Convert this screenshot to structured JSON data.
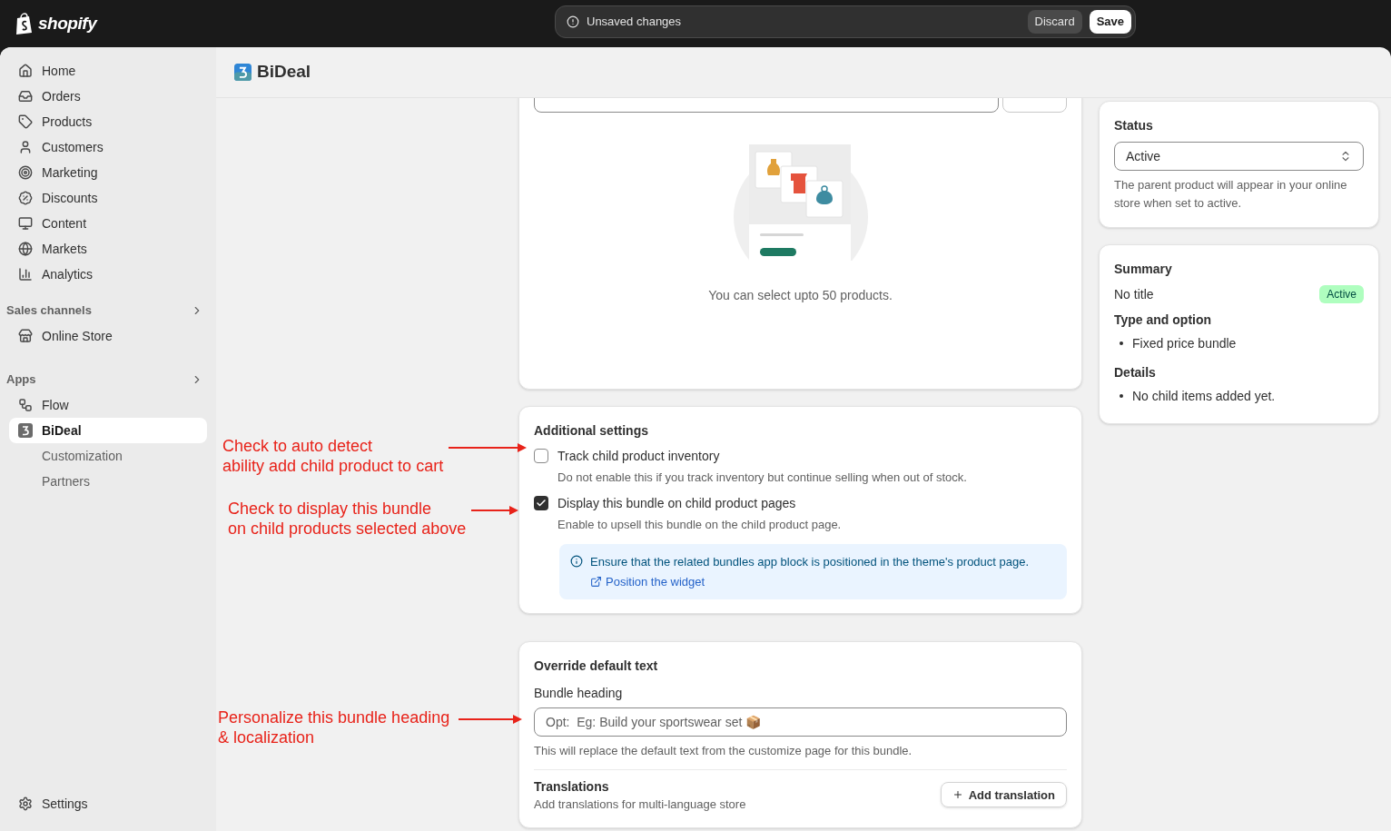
{
  "topbar": {
    "logo": "shopify",
    "message": "Unsaved changes",
    "discard": "Discard",
    "save": "Save"
  },
  "sidebar": {
    "items": [
      {
        "label": "Home",
        "selected": false
      },
      {
        "label": "Orders",
        "selected": false
      },
      {
        "label": "Products",
        "selected": false
      },
      {
        "label": "Customers",
        "selected": false
      },
      {
        "label": "Marketing",
        "selected": false
      },
      {
        "label": "Discounts",
        "selected": false
      },
      {
        "label": "Content",
        "selected": false
      },
      {
        "label": "Markets",
        "selected": false
      },
      {
        "label": "Analytics",
        "selected": false
      }
    ],
    "sales_channels": {
      "title": "Sales channels",
      "items": [
        {
          "label": "Online Store",
          "selected": false
        }
      ]
    },
    "apps": {
      "title": "Apps",
      "items": [
        {
          "label": "Flow",
          "selected": false
        },
        {
          "label": "BiDeal",
          "selected": true,
          "children": [
            {
              "label": "Customization",
              "selected": false
            },
            {
              "label": "Partners",
              "selected": false
            }
          ]
        }
      ]
    },
    "settings": "Settings"
  },
  "page": {
    "title": "BiDeal"
  },
  "products_card": {
    "note": "You can select upto 50 products."
  },
  "additional_settings": {
    "title": "Additional settings",
    "options": [
      {
        "label": "Track child product inventory",
        "help": "Do not enable this if you track inventory but continue selling when out of stock.",
        "checked": false
      },
      {
        "label": "Display this bundle on child product pages",
        "help": "Enable to upsell this bundle on the child product page.",
        "checked": true
      }
    ],
    "banner": {
      "text": "Ensure that the related bundles app block is positioned in the theme's product page.",
      "link": "Position the widget"
    }
  },
  "override": {
    "title": "Override default text",
    "field_label": "Bundle heading",
    "placeholder": "Opt:  Eg: Build your sportswear set 📦",
    "help": "This will replace the default text from the customize page for this bundle.",
    "translations_title": "Translations",
    "translations_help": "Add translations for multi-language store",
    "add_translation": "Add translation"
  },
  "status": {
    "title": "Status",
    "value": "Active",
    "help": "The parent product will appear in your online store when set to active."
  },
  "summary": {
    "title": "Summary",
    "name": "No title",
    "badge": "Active",
    "sections": [
      {
        "heading": "Type and option",
        "items": [
          "Fixed price bundle"
        ]
      },
      {
        "heading": "Details",
        "items": [
          "No child items added yet."
        ]
      }
    ]
  },
  "annotations": [
    {
      "text": "Check to auto detect\nability add child product to cart"
    },
    {
      "text": "Check to display this bundle\non child products selected above"
    },
    {
      "text": "Personalize this bundle heading\n& localization"
    }
  ]
}
